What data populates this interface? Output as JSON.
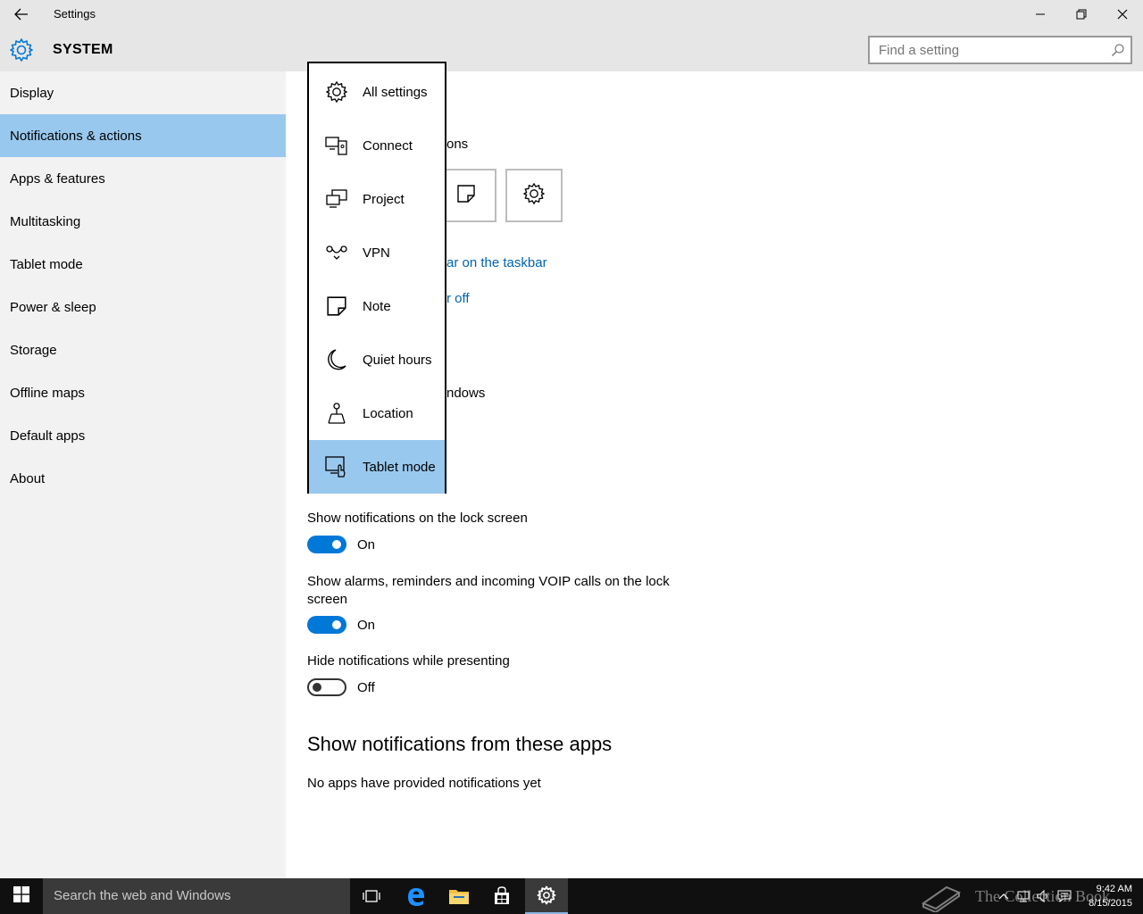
{
  "window": {
    "title": "Settings"
  },
  "header": {
    "section": "SYSTEM"
  },
  "search": {
    "placeholder": "Find a setting"
  },
  "sidebar": {
    "items": [
      {
        "label": "Display"
      },
      {
        "label": "Notifications & actions",
        "active": true
      },
      {
        "label": "Apps & features"
      },
      {
        "label": "Multitasking"
      },
      {
        "label": "Tablet mode"
      },
      {
        "label": "Power & sleep"
      },
      {
        "label": "Storage"
      },
      {
        "label": "Offline maps"
      },
      {
        "label": "Default apps"
      },
      {
        "label": "About"
      }
    ]
  },
  "main": {
    "quick_actions_partial": "ons",
    "link_taskbar_partial": "ar on the taskbar",
    "link_off_partial": "r off",
    "windows_partial": "ndows",
    "lock_screen": {
      "label": "Show notifications on the lock screen",
      "state": "On"
    },
    "alarms": {
      "label": "Show alarms, reminders and incoming VOIP calls on the lock screen",
      "state": "On"
    },
    "presenting": {
      "label": "Hide notifications while presenting",
      "state": "Off"
    },
    "apps_heading": "Show notifications from these apps",
    "apps_empty": "No apps have provided notifications yet"
  },
  "flyout": {
    "items": [
      {
        "label": "All settings",
        "icon": "gear-icon"
      },
      {
        "label": "Connect",
        "icon": "connect-icon"
      },
      {
        "label": "Project",
        "icon": "project-icon"
      },
      {
        "label": "VPN",
        "icon": "vpn-icon"
      },
      {
        "label": "Note",
        "icon": "note-icon"
      },
      {
        "label": "Quiet hours",
        "icon": "moon-icon"
      },
      {
        "label": "Location",
        "icon": "location-icon"
      },
      {
        "label": "Tablet mode",
        "icon": "tablet-mode-icon",
        "selected": true
      }
    ]
  },
  "taskbar": {
    "search_placeholder": "Search the web and Windows",
    "time": "9:42 AM",
    "date": "8/15/2015",
    "watermark": "The Collection Book"
  },
  "colors": {
    "accent": "#0078d7",
    "selection": "#99c8ee",
    "link": "#0063b1",
    "sidebar_bg": "#f2f2f2",
    "titlebar_bg": "#e6e6e6"
  }
}
